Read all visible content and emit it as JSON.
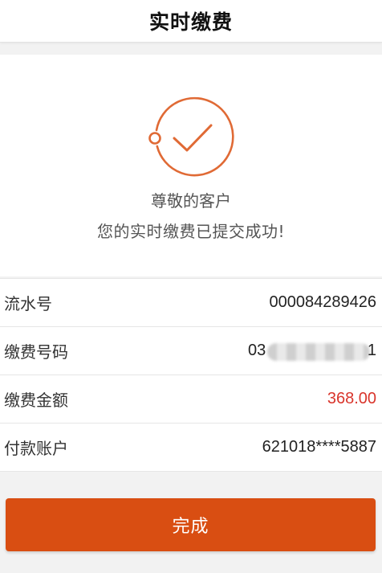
{
  "header": {
    "title": "实时缴费"
  },
  "success": {
    "icon": "check-circle-icon",
    "line1": "尊敬的客户",
    "line2": "您的实时缴费已提交成功!"
  },
  "details": {
    "serial": {
      "label": "流水号",
      "value": "000084289426"
    },
    "payment_number": {
      "label": "缴费号码",
      "value_prefix": "03",
      "value_suffix": "1"
    },
    "amount": {
      "label": "缴费金额",
      "value": "368.00"
    },
    "account": {
      "label": "付款账户",
      "value": "621018****5887"
    }
  },
  "actions": {
    "done_label": "完成"
  },
  "colors": {
    "accent": "#d94e12",
    "amount": "#d9352c"
  }
}
